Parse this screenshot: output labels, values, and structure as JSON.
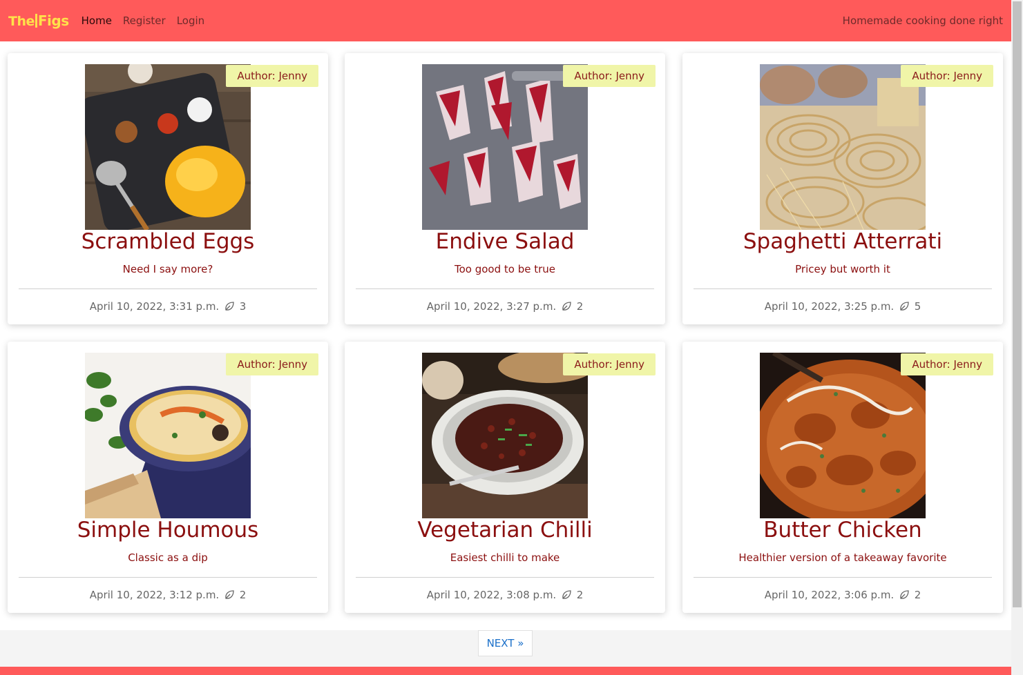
{
  "brand": {
    "part1": "The",
    "part2": "Figs"
  },
  "nav": [
    {
      "label": "Home",
      "active": true
    },
    {
      "label": "Register",
      "active": false
    },
    {
      "label": "Login",
      "active": false
    }
  ],
  "tagline": "Homemade cooking done right",
  "posts": [
    {
      "author": "Author: Jenny",
      "title": "Scrambled Eggs",
      "excerpt": "Need I say more?",
      "date": "April 10, 2022, 3:31 p.m.",
      "likes": "3"
    },
    {
      "author": "Author: Jenny",
      "title": "Endive Salad",
      "excerpt": "Too good to be true",
      "date": "April 10, 2022, 3:27 p.m.",
      "likes": "2"
    },
    {
      "author": "Author: Jenny",
      "title": "Spaghetti Atterrati",
      "excerpt": "Pricey but worth it",
      "date": "April 10, 2022, 3:25 p.m.",
      "likes": "5"
    },
    {
      "author": "Author: Jenny",
      "title": "Simple Houmous",
      "excerpt": "Classic as a dip",
      "date": "April 10, 2022, 3:12 p.m.",
      "likes": "2"
    },
    {
      "author": "Author: Jenny",
      "title": "Vegetarian Chilli",
      "excerpt": "Easiest chilli to make",
      "date": "April 10, 2022, 3:08 p.m.",
      "likes": "2"
    },
    {
      "author": "Author: Jenny",
      "title": "Butter Chicken",
      "excerpt": "Healthier version of a takeaway favorite",
      "date": "April 10, 2022, 3:06 p.m.",
      "likes": "2"
    }
  ],
  "pagination": {
    "next_label": "NEXT »"
  },
  "colors": {
    "navbar": "#ff5a5a",
    "brand": "#ffe14a",
    "title": "#8b0f0f",
    "badge_bg": "#f0f5a8",
    "link": "#1a6fc9"
  }
}
